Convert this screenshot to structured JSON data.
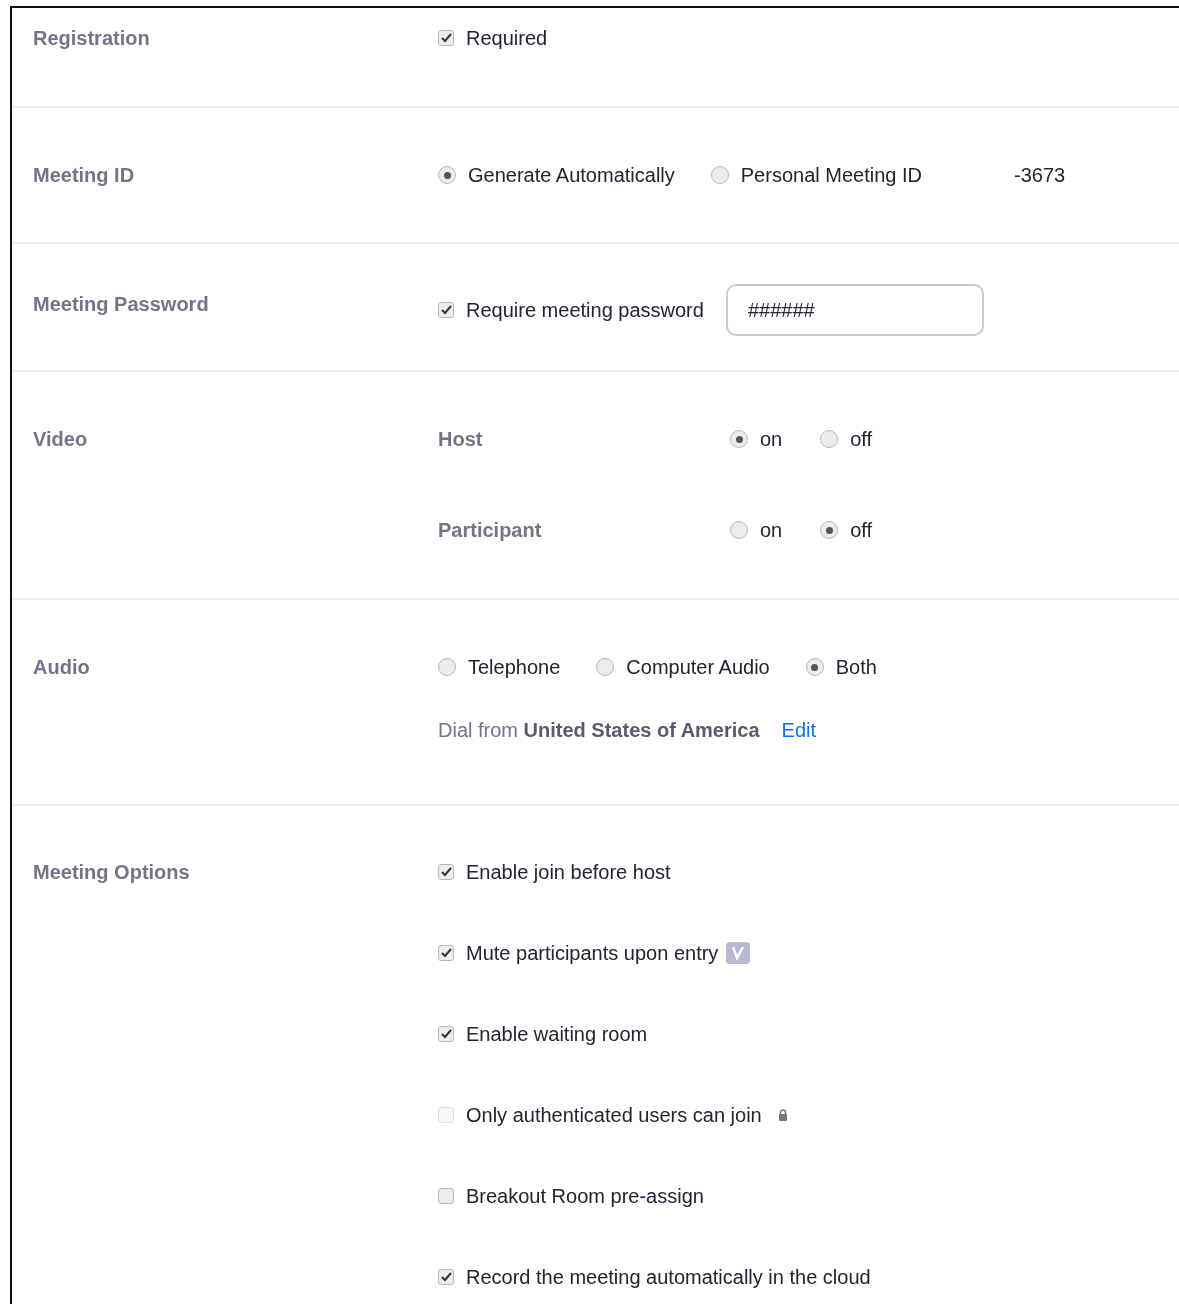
{
  "sections": [
    {
      "kind": "checks",
      "label": "Registration",
      "items": [
        {
          "label": "Required",
          "checked": true,
          "disabled": false
        }
      ]
    },
    {
      "kind": "meeting_id",
      "label": "Meeting ID",
      "options": [
        {
          "label": "Generate Automatically",
          "selected": true
        },
        {
          "label": "Personal Meeting ID",
          "selected": false
        }
      ],
      "id_value": "-3673"
    },
    {
      "kind": "password",
      "label": "Meeting Password",
      "check": {
        "label": "Require meeting password",
        "checked": true
      },
      "value": "######"
    },
    {
      "kind": "video",
      "label": "Video",
      "rows": [
        {
          "label": "Host",
          "options": [
            {
              "label": "on",
              "selected": true
            },
            {
              "label": "off",
              "selected": false
            }
          ]
        },
        {
          "label": "Participant",
          "options": [
            {
              "label": "on",
              "selected": false
            },
            {
              "label": "off",
              "selected": true
            }
          ]
        }
      ]
    },
    {
      "kind": "audio",
      "label": "Audio",
      "options": [
        {
          "label": "Telephone",
          "selected": false
        },
        {
          "label": "Computer Audio",
          "selected": false
        },
        {
          "label": "Both",
          "selected": true
        }
      ],
      "dial_text": "Dial from **United States of America**",
      "edit_link": "Edit"
    },
    {
      "kind": "checks",
      "label": "Meeting Options",
      "items": [
        {
          "label": "Enable join before host",
          "checked": true,
          "disabled": false
        },
        {
          "label": "Mute participants upon entry",
          "checked": true,
          "disabled": false,
          "badge": true
        },
        {
          "label": "Enable waiting room",
          "checked": true,
          "disabled": false
        },
        {
          "label": "Only authenticated users can join",
          "checked": false,
          "disabled": true,
          "lock": true
        },
        {
          "label": "Breakout Room pre-assign",
          "checked": false,
          "disabled": false
        },
        {
          "label": "Record the meeting automatically in the cloud",
          "checked": true,
          "disabled": false
        }
      ]
    }
  ]
}
